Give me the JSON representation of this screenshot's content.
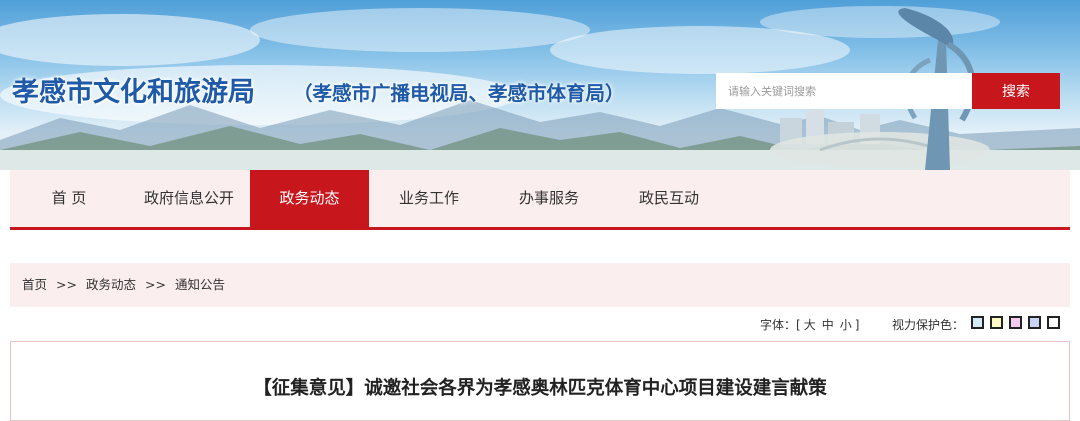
{
  "header": {
    "title": "孝感市文化和旅游局",
    "subtitle": "（孝感市广播电视局、孝感市体育局）",
    "search": {
      "placeholder": "请输入关键词搜索",
      "button_label": "搜索"
    }
  },
  "nav": {
    "items": [
      {
        "label": "首 页",
        "active": false
      },
      {
        "label": "政府信息公开",
        "active": false
      },
      {
        "label": "政务动态",
        "active": true
      },
      {
        "label": "业务工作",
        "active": false
      },
      {
        "label": "办事服务",
        "active": false
      },
      {
        "label": "政民互动",
        "active": false
      }
    ],
    "accent_color": "#c8161d"
  },
  "breadcrumb": {
    "items": [
      "首页",
      "政务动态",
      "通知公告"
    ],
    "separator": ">>"
  },
  "tools": {
    "font_label": "字体：[",
    "font_sizes": [
      "大",
      "中",
      "小"
    ],
    "font_close": "]",
    "eye_label": "视力保护色：",
    "eye_colors": [
      "#d6e9f7",
      "#fff7c4",
      "#f6c9ef",
      "#c9d3f6",
      "#ffffff"
    ]
  },
  "article": {
    "title": "【征集意见】诚邀社会各界为孝感奥林匹克体育中心项目建设建言献策"
  }
}
